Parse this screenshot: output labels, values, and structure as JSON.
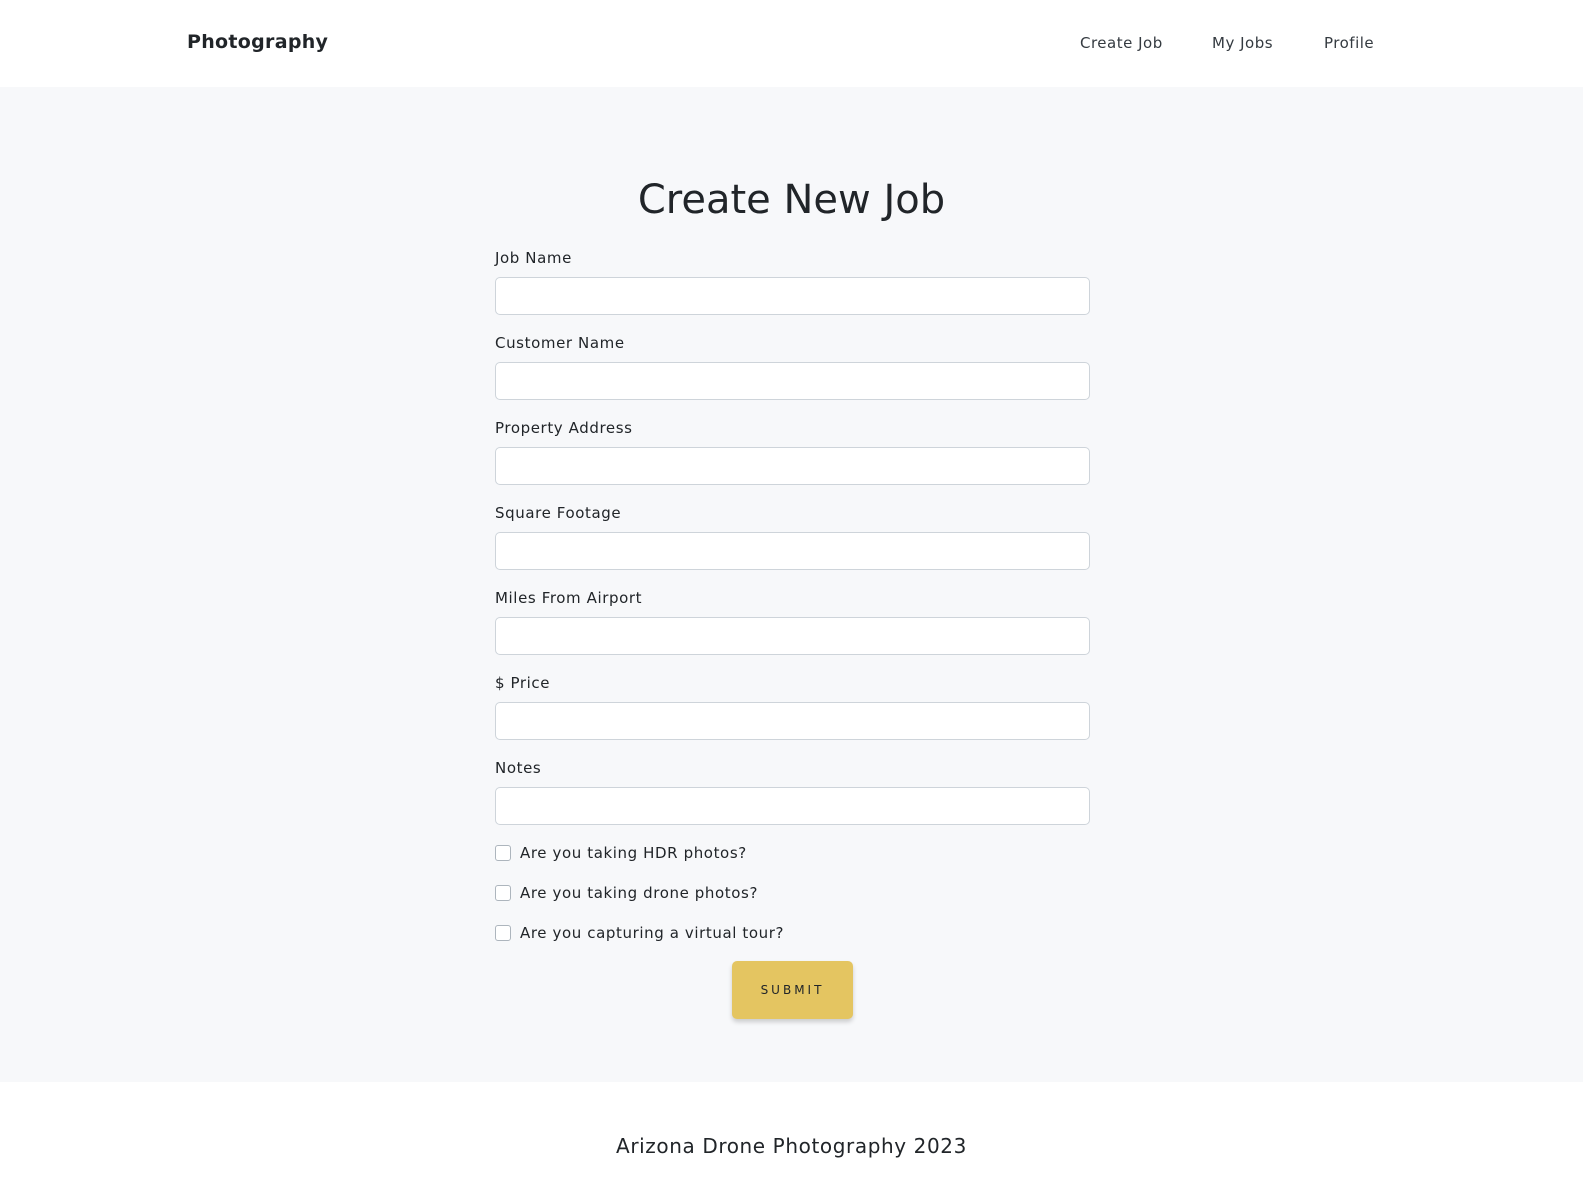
{
  "navbar": {
    "brand": "Photography",
    "links": [
      {
        "label": "Create Job"
      },
      {
        "label": "My Jobs"
      },
      {
        "label": "Profile"
      }
    ]
  },
  "form": {
    "title": "Create New Job",
    "fields": [
      {
        "label": "Job Name",
        "value": "",
        "placeholder": ""
      },
      {
        "label": "Customer Name",
        "value": "",
        "placeholder": ""
      },
      {
        "label": "Property Address",
        "value": "",
        "placeholder": ""
      },
      {
        "label": "Square Footage",
        "value": "",
        "placeholder": ""
      },
      {
        "label": "Miles From Airport",
        "value": "",
        "placeholder": ""
      },
      {
        "label": "$ Price",
        "value": "",
        "placeholder": ""
      },
      {
        "label": "Notes",
        "value": "",
        "placeholder": ""
      }
    ],
    "checkboxes": [
      {
        "label": "Are you taking HDR photos?",
        "checked": false
      },
      {
        "label": "Are you taking drone photos?",
        "checked": false
      },
      {
        "label": "Are you capturing a virtual tour?",
        "checked": false
      }
    ],
    "submit_label": "SUBMIT"
  },
  "footer": {
    "text": "Arizona Drone Photography 2023"
  },
  "colors": {
    "accent": "#e4c561",
    "background": "#f7f8fa",
    "surface": "#ffffff",
    "text": "#212529"
  }
}
